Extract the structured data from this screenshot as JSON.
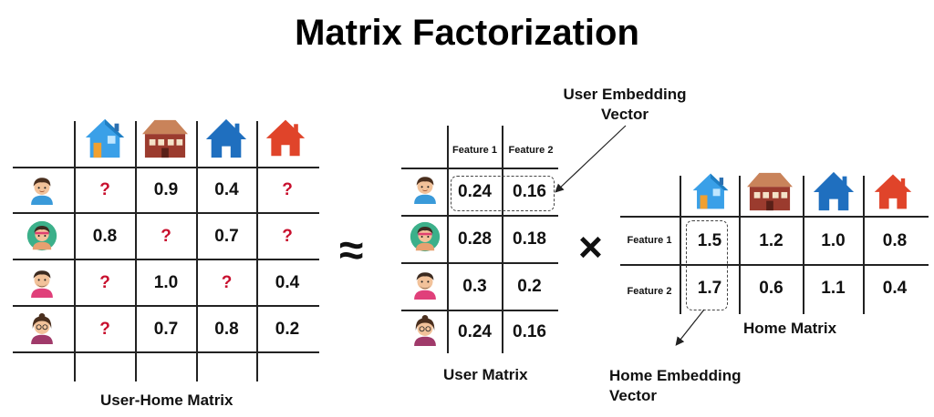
{
  "title": "Matrix Factorization",
  "symbols": {
    "approx": "≈",
    "times": "×"
  },
  "user_home_matrix": {
    "label": "User-Home Matrix",
    "users": [
      "user-1-avatar",
      "user-2-avatar",
      "user-3-avatar",
      "user-4-avatar"
    ],
    "homes": [
      "home-1-icon",
      "home-2-icon",
      "home-3-icon",
      "home-4-icon"
    ],
    "rows": [
      [
        "?",
        "0.9",
        "0.4",
        "?"
      ],
      [
        "0.8",
        "?",
        "0.7",
        "?"
      ],
      [
        "?",
        "1.0",
        "?",
        "0.4"
      ],
      [
        "?",
        "0.7",
        "0.8",
        "0.2"
      ]
    ]
  },
  "user_matrix": {
    "label": "User Matrix",
    "headers": [
      "Feature 1",
      "Feature 2"
    ],
    "rows": [
      [
        "0.24",
        "0.16"
      ],
      [
        "0.28",
        "0.18"
      ],
      [
        "0.3",
        "0.2"
      ],
      [
        "0.24",
        "0.16"
      ]
    ]
  },
  "home_matrix": {
    "label": "Home Matrix",
    "row_headers": [
      "Feature 1",
      "Feature 2"
    ],
    "rows": [
      [
        "1.5",
        "1.2",
        "1.0",
        "0.8"
      ],
      [
        "1.7",
        "0.6",
        "1.1",
        "0.4"
      ]
    ]
  },
  "annotations": {
    "user_embedding_line1": "User Embedding",
    "user_embedding_line2": "Vector",
    "home_embedding_line1": "Home Embedding",
    "home_embedding_line2": "Vector"
  },
  "colors": {
    "question": "#c8102e",
    "home_light_blue": "#3aa0e8",
    "home_brown": "#9b3b2e",
    "home_blue": "#1f6fbf",
    "home_red": "#e0442a",
    "skin": "#f2c29a",
    "teal_shirt": "#3cc3c3",
    "pink_shirt": "#e0407a"
  }
}
